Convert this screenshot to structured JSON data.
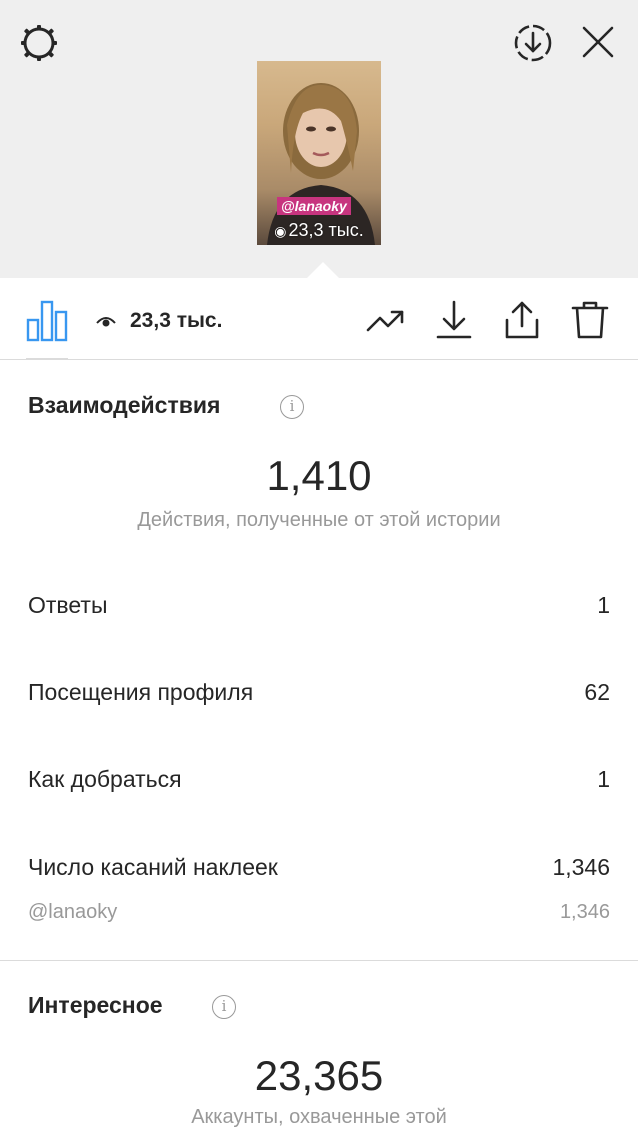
{
  "header": {
    "story_tag": "@lanaoky",
    "story_views": "23,3 тыс."
  },
  "toolbar": {
    "views": "23,3 тыс."
  },
  "interactions": {
    "title": "Взаимодействия",
    "info": "i",
    "total": "1,410",
    "caption": "Действия, полученные от этой истории",
    "rows": [
      {
        "label": "Ответы",
        "value": "1"
      },
      {
        "label": "Посещения профиля",
        "value": "62"
      },
      {
        "label": "Как добраться",
        "value": "1"
      },
      {
        "label": "Число касаний наклеек",
        "value": "1,346"
      },
      {
        "label": "@lanaoky",
        "value": "1,346"
      }
    ]
  },
  "discovery": {
    "title": "Интересное",
    "info": "i",
    "total": "23,365",
    "caption": "Аккаунты, охваченные этой"
  },
  "colors": {
    "accent": "#3897f0",
    "tag": "#c7357f",
    "muted": "#999999",
    "text": "#262626"
  },
  "icons": [
    "settings-gear-icon",
    "save-download-icon",
    "close-icon",
    "bar-chart-icon",
    "eye-icon",
    "trend-icon",
    "download-icon",
    "share-icon",
    "trash-icon",
    "info-icon"
  ]
}
